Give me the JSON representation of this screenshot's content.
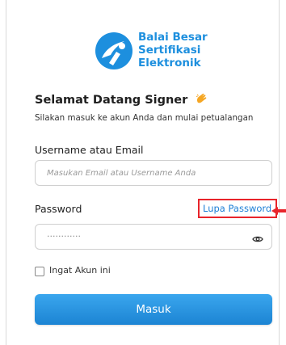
{
  "brand": {
    "lines": [
      "Balai Besar",
      "Sertifikasi",
      "Elektronik"
    ],
    "color": "#1d8fde"
  },
  "welcome": {
    "title": "Selamat Datang Signer",
    "icon": "waving-hand-icon",
    "subtitle": "Silakan masuk ke akun Anda dan mulai petualangan"
  },
  "form": {
    "username_label": "Username atau Email",
    "username_placeholder": "Masukan Email atau Username Anda",
    "password_label": "Password",
    "password_value": "············",
    "forgot_label": "Lupa Password",
    "remember_label": "Ingat Akun ini",
    "submit_label": "Masuk"
  },
  "highlight_color": "#e8242b",
  "accent": "#1d84d3"
}
